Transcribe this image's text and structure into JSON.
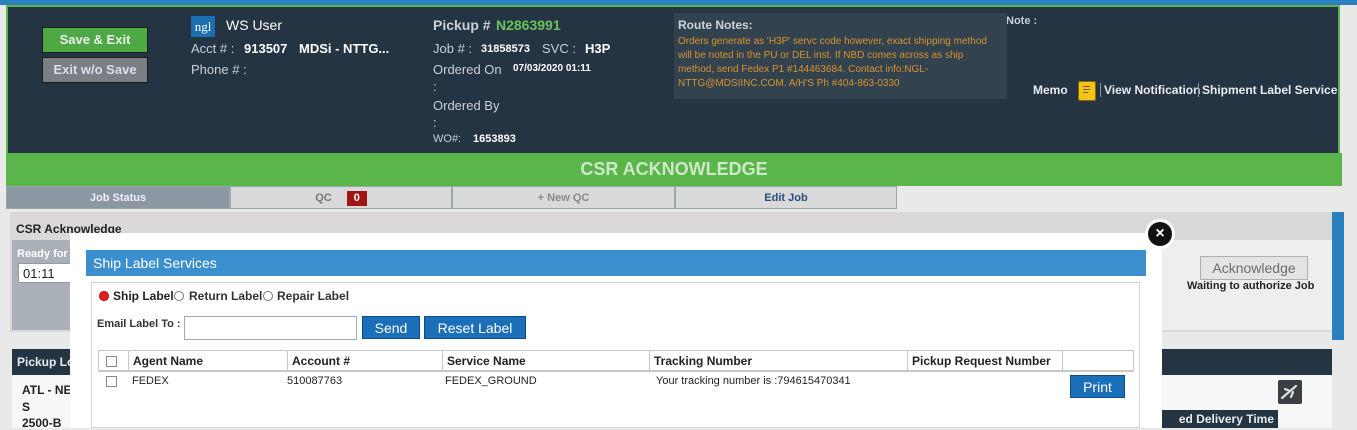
{
  "header": {
    "save_exit": "Save & Exit",
    "exit_wo_save": "Exit w/o Save",
    "logo_text": "ngl",
    "user": "WS User",
    "acct_label": "Acct # :",
    "acct_value": "913507",
    "acct_name": "MDSi - NTTG...",
    "phone_label": "Phone # :",
    "pickup_label": "Pickup #",
    "pickup_value": "N2863991",
    "job_label": "Job # :",
    "job_value": "31858573",
    "svc_label": "SVC :",
    "svc_value": "H3P",
    "ordered_on_label": "Ordered On",
    "ordered_on_value": "07/03/2020 01:11",
    "colon1": ":",
    "ordered_by_label": "Ordered By",
    "colon2": ":",
    "wo_label": "WO#:",
    "wo_value": "1653893",
    "route_notes_title": "Route Notes:",
    "route_notes_text": "Orders generate as 'H3P' servc code however, exact shipping method will be noted in the PU or DEL inst. If NBD comes across as ship method, send Fedex P1 #144463684. Contact info:NGL-NTTG@MDSIINC.COM. A/H'S Ph #404-863-0330",
    "note_label": "Note :",
    "memo_label": "Memo",
    "view_notification": "View Notification",
    "shipment_label_service": "Shipment Label Service"
  },
  "banner": "CSR ACKNOWLEDGE",
  "tabs": {
    "job_status": "Job Status",
    "qc": "QC",
    "qc_count": "0",
    "new_qc": "+ New QC",
    "edit_job": "Edit Job"
  },
  "background": {
    "csr_title": "CSR Acknowledge",
    "ready_for": "Ready for",
    "time_value": "01:11",
    "acknowledge_btn": "Acknowledge",
    "waiting": "Waiting to authorize Job",
    "pickup_loc": "Pickup Lo",
    "atl_ne": "ATL - NE",
    "s_line": "S",
    "addr_line": "2500-B",
    "delivery_time": "ed Delivery Time"
  },
  "modal": {
    "title": "Ship Label Services",
    "close": "×",
    "radios": [
      {
        "label": "Ship Label",
        "checked": true
      },
      {
        "label": "Return Label",
        "checked": false
      },
      {
        "label": "Repair Label",
        "checked": false
      }
    ],
    "email_label": "Email Label To :",
    "email_value": "",
    "send": "Send",
    "reset": "Reset Label",
    "columns": [
      "Agent Name",
      "Account #",
      "Service Name",
      "Tracking Number",
      "Pickup Request Number"
    ],
    "rows": [
      {
        "agent": "FEDEX",
        "account": "510087763",
        "service": "FEDEX_GROUND",
        "tracking": "Your tracking number is :794615470341",
        "pickup_request": "",
        "action": "Print"
      }
    ]
  },
  "colors": {
    "header_bg": "#253442",
    "green": "#5ab54b",
    "accent_blue": "#3b8fcf",
    "button_blue": "#1b6fb8",
    "pickup_green": "#6ac35a",
    "route_notes_orange": "#d9932b",
    "qc_badge_red": "#a31515"
  },
  "icons": {
    "memo": "memo-note-icon",
    "close": "close-icon",
    "airplane": "airplane-icon"
  }
}
